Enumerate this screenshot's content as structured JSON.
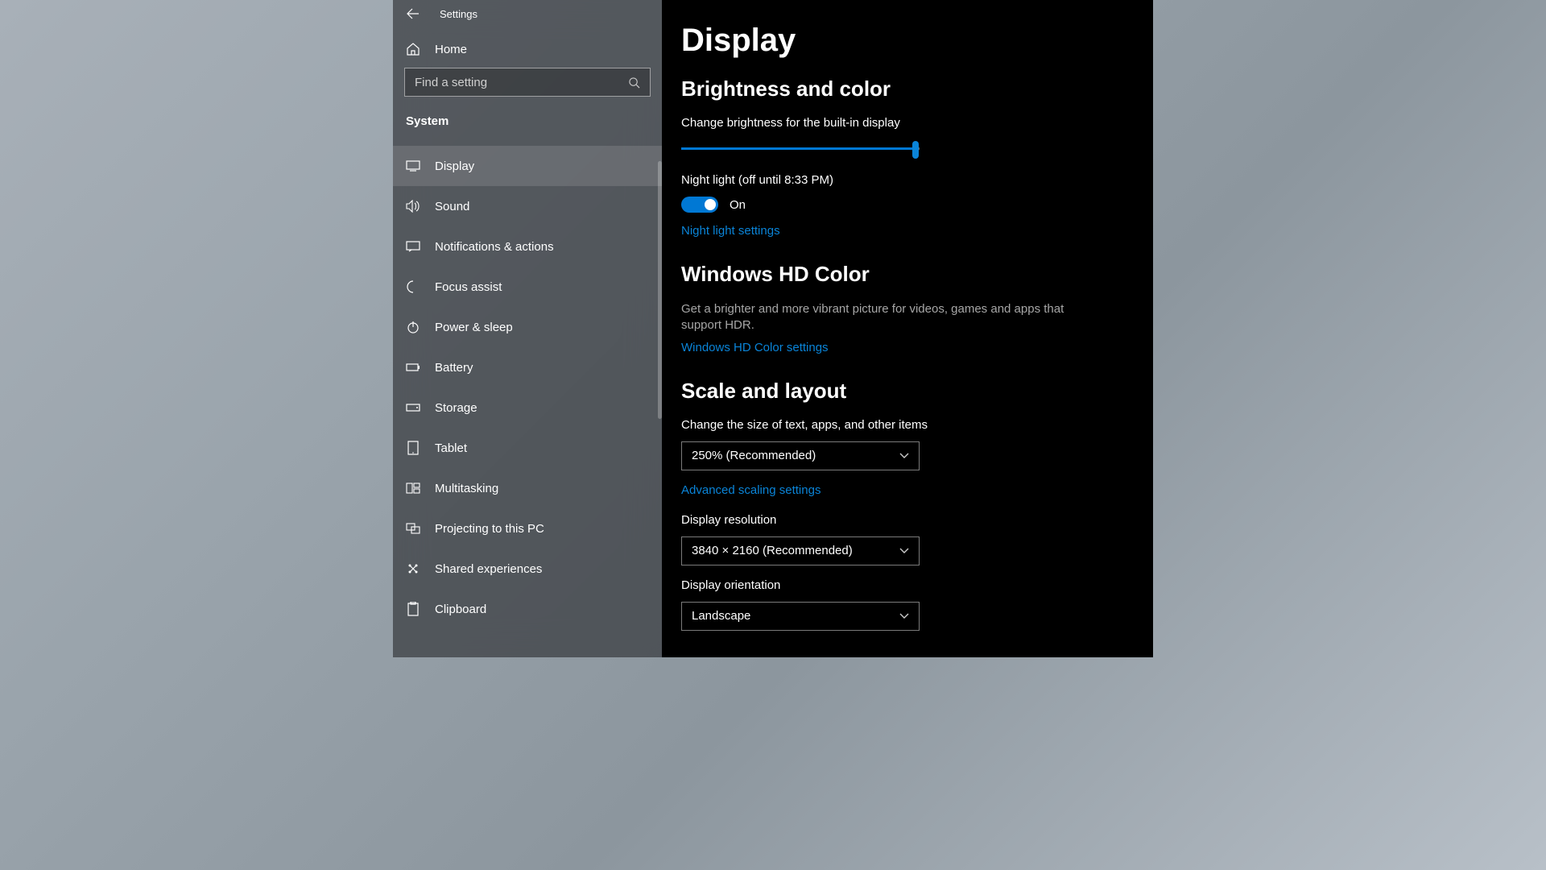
{
  "titlebar": {
    "label": "Settings"
  },
  "home": {
    "label": "Home"
  },
  "search": {
    "placeholder": "Find a setting"
  },
  "category": "System",
  "sidebar": {
    "items": [
      {
        "label": "Display"
      },
      {
        "label": "Sound"
      },
      {
        "label": "Notifications & actions"
      },
      {
        "label": "Focus assist"
      },
      {
        "label": "Power & sleep"
      },
      {
        "label": "Battery"
      },
      {
        "label": "Storage"
      },
      {
        "label": "Tablet"
      },
      {
        "label": "Multitasking"
      },
      {
        "label": "Projecting to this PC"
      },
      {
        "label": "Shared experiences"
      },
      {
        "label": "Clipboard"
      }
    ]
  },
  "main": {
    "title": "Display",
    "brightness": {
      "section_title": "Brightness and color",
      "slider_label": "Change brightness for the built-in display",
      "night_light_label": "Night light (off until 8:33 PM)",
      "night_light_state": "On",
      "night_light_link": "Night light settings"
    },
    "hdcolor": {
      "section_title": "Windows HD Color",
      "desc": "Get a brighter and more vibrant picture for videos, games and apps that support HDR.",
      "link": "Windows HD Color settings"
    },
    "scale": {
      "section_title": "Scale and layout",
      "size_label": "Change the size of text, apps, and other items",
      "size_value": "250% (Recommended)",
      "advanced_link": "Advanced scaling settings",
      "resolution_label": "Display resolution",
      "resolution_value": "3840 × 2160 (Recommended)",
      "orientation_label": "Display orientation",
      "orientation_value": "Landscape"
    }
  }
}
